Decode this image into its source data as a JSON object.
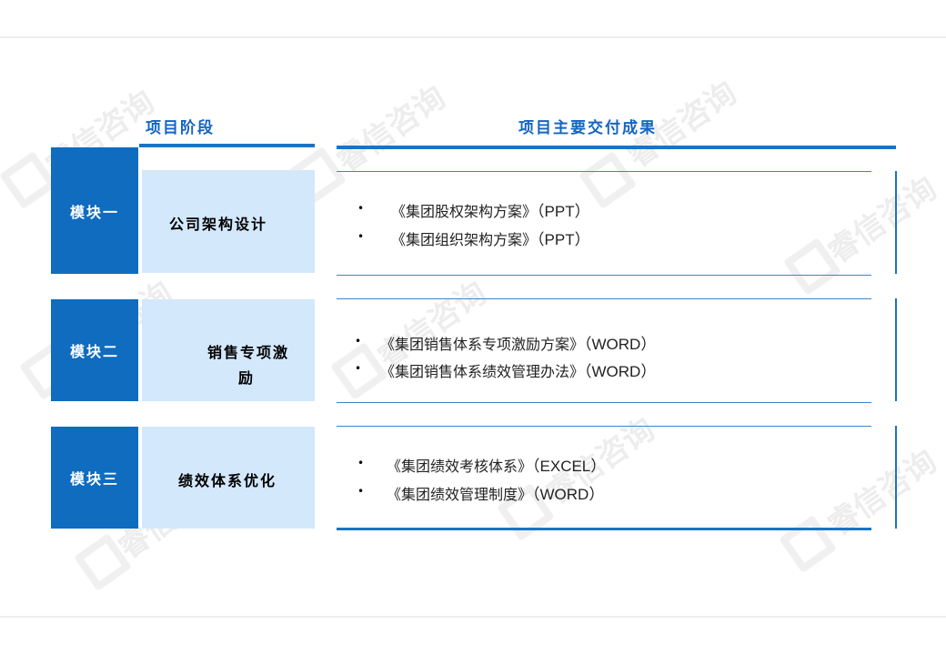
{
  "headers": {
    "stage": "项目阶段",
    "deliverables": "项目主要交付成果"
  },
  "watermark": "睿信咨询",
  "rows": [
    {
      "module": "模块一",
      "stage": [
        "公司架构设计"
      ],
      "items": [
        {
          "title": "《集团股权架构方案》",
          "format": "（PPT）"
        },
        {
          "title": "《集团组织架构方案》",
          "format": "（PPT）"
        }
      ]
    },
    {
      "module": "模块二",
      "stage": [
        "销售专项激",
        "励"
      ],
      "items": [
        {
          "title": "《集团销售体系专项激励方案》",
          "format": "（WORD）"
        },
        {
          "title": "《集团销售体系绩效管理办法》",
          "format": "（WORD）"
        }
      ]
    },
    {
      "module": "模块三",
      "stage": [
        "绩效体系优化"
      ],
      "items": [
        {
          "title": "《集团绩效考核体系》",
          "format": "（EXCEL）"
        },
        {
          "title": "《集团绩效管理制度》",
          "format": "（WORD）"
        }
      ]
    }
  ]
}
